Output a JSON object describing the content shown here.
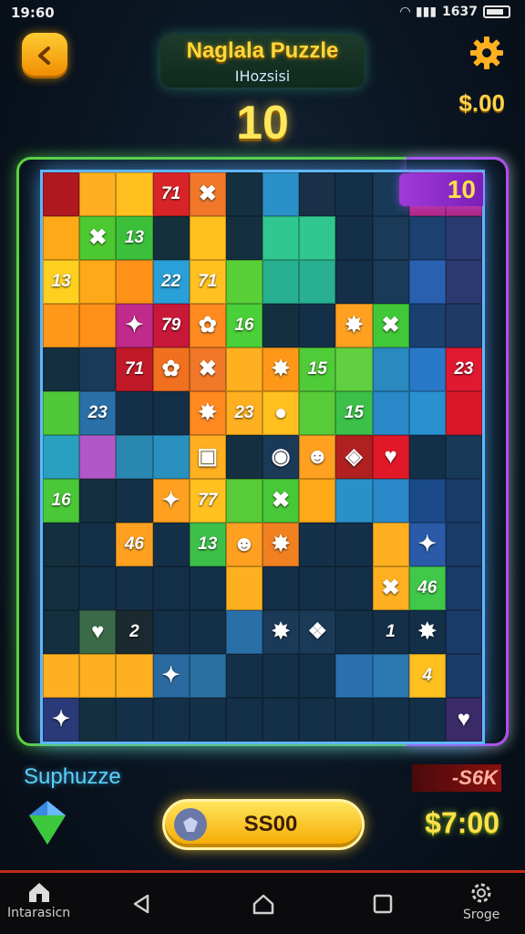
{
  "status": {
    "time": "19:60",
    "right_text": "1637"
  },
  "header": {
    "title": "Naglala Puzzle",
    "subtitle": "IHozsisi",
    "score": "10",
    "money": "$.00"
  },
  "board": {
    "badge": "10",
    "rows": [
      [
        {
          "c": "#b01820"
        },
        {
          "c": "#ffb020"
        },
        {
          "c": "#ffc020"
        },
        {
          "c": "#d82428",
          "t": "71"
        },
        {
          "c": "#f07828",
          "i": "✖"
        },
        {
          "c": "#143040"
        },
        {
          "c": "#2a90c8"
        },
        {
          "c": "#183048"
        },
        {
          "c": "#143048"
        },
        {
          "c": "#183a58"
        },
        {
          "c": "#b22a8a"
        },
        {
          "c": "#b02a8a"
        }
      ],
      [
        {
          "c": "#ffa818"
        },
        {
          "c": "#4cc830",
          "i": "✖"
        },
        {
          "c": "#3cc03c",
          "t": "13"
        },
        {
          "c": "#14303c"
        },
        {
          "c": "#ffc020"
        },
        {
          "c": "#143040"
        },
        {
          "c": "#30c890"
        },
        {
          "c": "#30c890"
        },
        {
          "c": "#143048"
        },
        {
          "c": "#1a3a58"
        },
        {
          "c": "#1c4070"
        },
        {
          "c": "#283a70"
        }
      ],
      [
        {
          "c": "#ffd020",
          "t": "13"
        },
        {
          "c": "#ffa818"
        },
        {
          "c": "#ff9018"
        },
        {
          "c": "#2aa0d8",
          "t": "22"
        },
        {
          "c": "#ffc020",
          "t": "71"
        },
        {
          "c": "#5ad038"
        },
        {
          "c": "#28b090"
        },
        {
          "c": "#28b090"
        },
        {
          "c": "#143048"
        },
        {
          "c": "#1a3a58"
        },
        {
          "c": "#2a60b0"
        },
        {
          "c": "#2a3a70"
        }
      ],
      [
        {
          "c": "#ff9818"
        },
        {
          "c": "#ff9018"
        },
        {
          "c": "#c02a8a",
          "i": "✦"
        },
        {
          "c": "#c81838",
          "t": "79"
        },
        {
          "c": "#ff8a20",
          "i": "✿"
        },
        {
          "c": "#4ad038",
          "t": "16"
        },
        {
          "c": "#143040"
        },
        {
          "c": "#143048"
        },
        {
          "c": "#ffa020",
          "i": "✸"
        },
        {
          "c": "#40c838",
          "i": "✖"
        },
        {
          "c": "#1a4070"
        },
        {
          "c": "#203a68"
        }
      ],
      [
        {
          "c": "#143040"
        },
        {
          "c": "#1a3a58"
        },
        {
          "c": "#c01a28",
          "t": "71"
        },
        {
          "c": "#f07020",
          "i": "✿"
        },
        {
          "c": "#f07828",
          "i": "✖"
        },
        {
          "c": "#ffb020"
        },
        {
          "c": "#ff9818",
          "i": "✸"
        },
        {
          "c": "#50cc38",
          "t": "15"
        },
        {
          "c": "#60d040"
        },
        {
          "c": "#2a8ac0"
        },
        {
          "c": "#2a78c8"
        },
        {
          "c": "#e01830",
          "t": "23"
        }
      ],
      [
        {
          "c": "#50c838"
        },
        {
          "c": "#2a70a8",
          "t": "23"
        },
        {
          "c": "#143048"
        },
        {
          "c": "#143048"
        },
        {
          "c": "#ff8a20",
          "i": "✸"
        },
        {
          "c": "#ffb020",
          "t": "23"
        },
        {
          "c": "#ffc020",
          "i": "●"
        },
        {
          "c": "#58cc38"
        },
        {
          "c": "#3cc048",
          "t": "15"
        },
        {
          "c": "#2a88c8"
        },
        {
          "c": "#2a90d0"
        },
        {
          "c": "#d81828"
        }
      ],
      [
        {
          "c": "#2aa0c0"
        },
        {
          "c": "#b058c8"
        },
        {
          "c": "#2a88b0"
        },
        {
          "c": "#2a90c0"
        },
        {
          "c": "#ffb020",
          "i": "▣"
        },
        {
          "c": "#143040"
        },
        {
          "c": "#1a3a58",
          "i": "◉"
        },
        {
          "c": "#ffa020",
          "i": "☻"
        },
        {
          "c": "#b02020",
          "i": "◈"
        },
        {
          "c": "#e01828",
          "i": "♥"
        },
        {
          "c": "#143048"
        },
        {
          "c": "#183a58"
        }
      ],
      [
        {
          "c": "#4ac838",
          "t": "16"
        },
        {
          "c": "#143040"
        },
        {
          "c": "#143048"
        },
        {
          "c": "#ffa020",
          "i": "✦"
        },
        {
          "c": "#ffc020",
          "t": "77"
        },
        {
          "c": "#58cc38"
        },
        {
          "c": "#48c838",
          "i": "✖"
        },
        {
          "c": "#ffa818"
        },
        {
          "c": "#2a90c8"
        },
        {
          "c": "#2a88c8"
        },
        {
          "c": "#1a4a88"
        },
        {
          "c": "#1a3a68"
        }
      ],
      [
        {
          "c": "#143040"
        },
        {
          "c": "#143048"
        },
        {
          "c": "#ffa020",
          "t": "46"
        },
        {
          "c": "#143048"
        },
        {
          "c": "#3cc048",
          "t": "13"
        },
        {
          "c": "#ffa020",
          "i": "☻"
        },
        {
          "c": "#f08020",
          "i": "✸"
        },
        {
          "c": "#143048"
        },
        {
          "c": "#143048"
        },
        {
          "c": "#ffb020"
        },
        {
          "c": "#2a5aa8",
          "i": "✦"
        },
        {
          "c": "#1a3a68"
        }
      ],
      [
        {
          "c": "#143040"
        },
        {
          "c": "#143048"
        },
        {
          "c": "#143048"
        },
        {
          "c": "#143048"
        },
        {
          "c": "#143048"
        },
        {
          "c": "#ffb020"
        },
        {
          "c": "#143048"
        },
        {
          "c": "#143048"
        },
        {
          "c": "#143048"
        },
        {
          "c": "#ffb020",
          "i": "✖"
        },
        {
          "c": "#40c848",
          "t": "46"
        },
        {
          "c": "#1a3a68"
        }
      ],
      [
        {
          "c": "#143040"
        },
        {
          "c": "#3a6a48",
          "i": "♥"
        },
        {
          "c": "#1a2a30",
          "t": "2"
        },
        {
          "c": "#143048"
        },
        {
          "c": "#143048"
        },
        {
          "c": "#2a70a8"
        },
        {
          "c": "#1a3a58",
          "i": "✸"
        },
        {
          "c": "#1a3a58",
          "i": "❖"
        },
        {
          "c": "#143048"
        },
        {
          "c": "#143048",
          "t": "1"
        },
        {
          "c": "#143048",
          "i": "✸"
        },
        {
          "c": "#1a3a68"
        }
      ],
      [
        {
          "c": "#ffb020"
        },
        {
          "c": "#ffb020"
        },
        {
          "c": "#ffb020"
        },
        {
          "c": "#2a6aa0",
          "i": "✦"
        },
        {
          "c": "#2a70a0"
        },
        {
          "c": "#143048"
        },
        {
          "c": "#143048"
        },
        {
          "c": "#143048"
        },
        {
          "c": "#2a70b0"
        },
        {
          "c": "#2a78b0"
        },
        {
          "c": "#ffc020",
          "t": "4"
        },
        {
          "c": "#1a3a68"
        }
      ],
      [
        {
          "c": "#2a3a78",
          "i": "✦"
        },
        {
          "c": "#143040"
        },
        {
          "c": "#143048"
        },
        {
          "c": "#143048"
        },
        {
          "c": "#143048"
        },
        {
          "c": "#143048"
        },
        {
          "c": "#143048"
        },
        {
          "c": "#143048"
        },
        {
          "c": "#143048"
        },
        {
          "c": "#143048"
        },
        {
          "c": "#143048"
        },
        {
          "c": "#3a2a68",
          "i": "♥"
        }
      ]
    ]
  },
  "footer": {
    "bonus_label": "Suphuzze",
    "penalty": "-S6K",
    "action_label": "SS00",
    "money": "$7:00"
  },
  "nav": {
    "left_label": "Intarasicn",
    "right_label": "Sroge"
  },
  "colors": {
    "accent_gold": "#ffd83a",
    "board_border": "#5fb6ff",
    "frame_green": "#5bd23c",
    "frame_purple": "#b14cf0"
  }
}
